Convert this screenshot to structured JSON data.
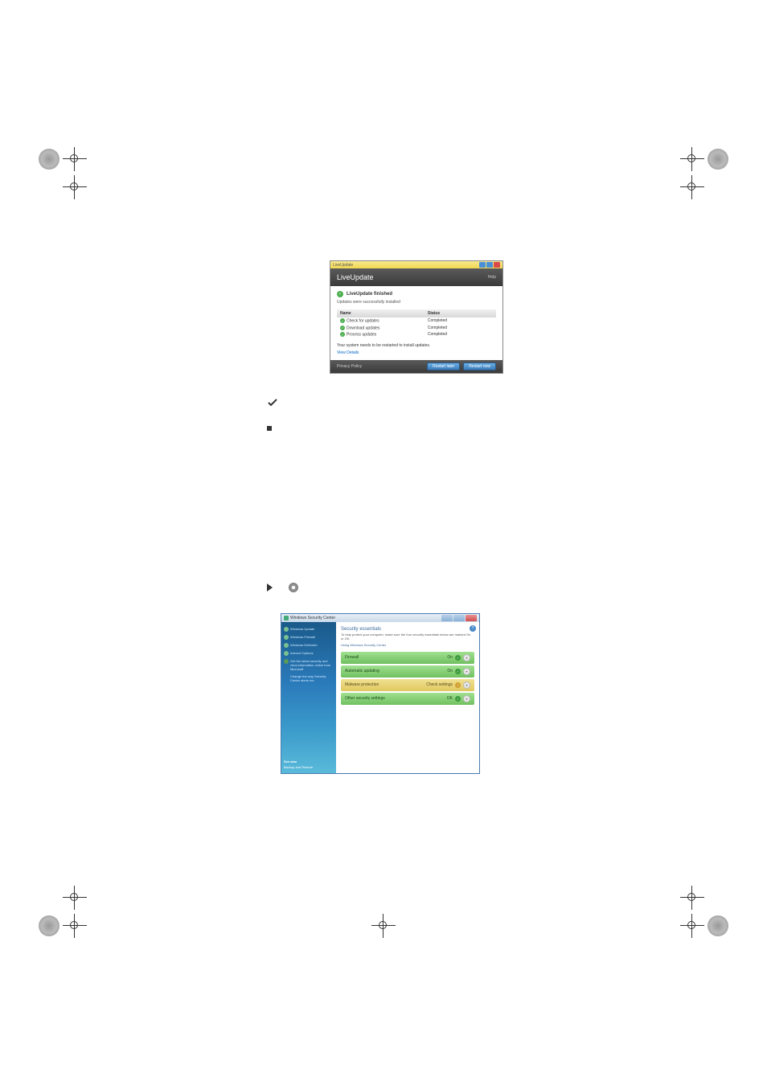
{
  "liveupdate": {
    "titlebar": "LiveUpdate",
    "header_title": "LiveUpdate",
    "header_help": "Help",
    "status_title": "LiveUpdate finished",
    "status_sub": "Updates were successfully installed",
    "table": {
      "col_name": "Name",
      "col_status": "Status",
      "rows": [
        {
          "name": "Check for updates",
          "status": "Completed"
        },
        {
          "name": "Download updates",
          "status": "Completed"
        },
        {
          "name": "Process updates",
          "status": "Completed"
        }
      ]
    },
    "restart_msg": "Your system needs to be restarted to install updates.",
    "view_details": "View Details",
    "privacy": "Privacy Policy",
    "btn_later": "Restart later",
    "btn_now": "Restart now"
  },
  "wsc": {
    "title": "Windows Security Center",
    "sidebar": {
      "items": [
        {
          "label": "Windows Update"
        },
        {
          "label": "Windows Firewall"
        },
        {
          "label": "Windows Defender"
        },
        {
          "label": "Internet Options"
        },
        {
          "label": "Get the latest security and virus information online from Microsoft"
        },
        {
          "label": "Change the way Security Center alerts me"
        }
      ],
      "footer_title": "See also",
      "footer_item": "Backup and Restore"
    },
    "main": {
      "title": "Security essentials",
      "sub": "To help protect your computer, make sure the four security essentials below are marked On or OK.",
      "link": "Using Windows Security Center",
      "sections": [
        {
          "label": "Firewall",
          "status": "On",
          "color": "green"
        },
        {
          "label": "Automatic updating",
          "status": "On",
          "color": "green"
        },
        {
          "label": "Malware protection",
          "status": "Check settings",
          "color": "yellow"
        },
        {
          "label": "Other security settings",
          "status": "OK",
          "color": "green"
        }
      ]
    }
  }
}
